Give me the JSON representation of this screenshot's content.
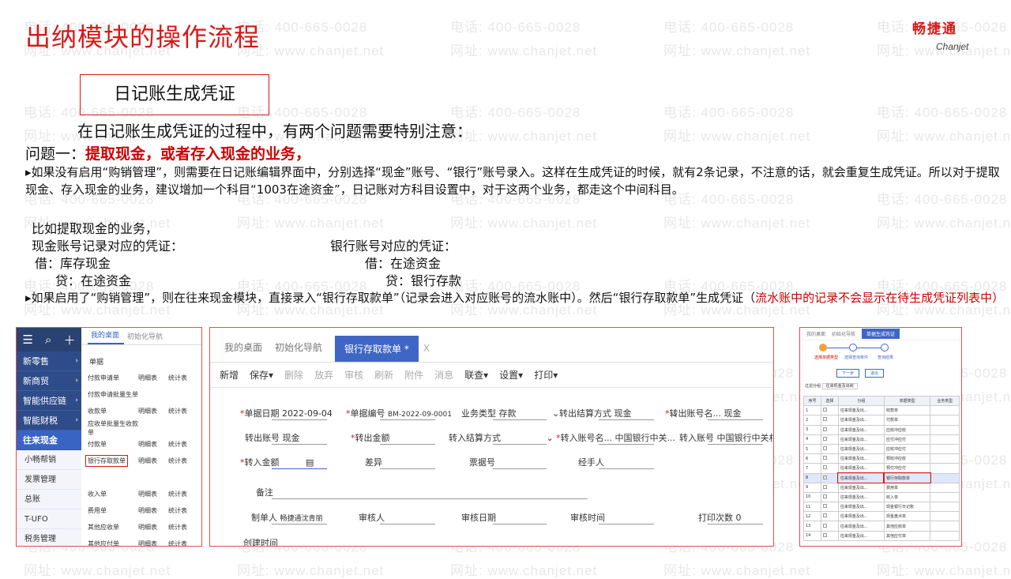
{
  "title": "出纳模块的操作流程",
  "logo": {
    "cn": "畅捷通",
    "en": "Chanjet"
  },
  "watermark": {
    "phone": "电话: 400-665-0028",
    "site": "网址: www.chanjet.net"
  },
  "section_box": "日记账生成凭证",
  "intro": "在日记账生成凭证的过程中，有两个问题需要特别注意：",
  "question1": {
    "prefix": "问题一：",
    "highlight": "提取现金，或者存入现金的业务，"
  },
  "para1": "▸如果没有启用“购销管理”，则需要在日记账编辑界面中，分别选择“现金”账号、“银行”账号录入。这样在生成凭证的时候，就有2条记录，不注意的话，就会重复生成凭证。所以对于提取现金、存入现金的业务，建议增加一个科目“1003在途资金”，日记账对方科目设置中，对于这两个业务，都走这个中间科目。",
  "example": {
    "line1": "比如提取现金的业务，",
    "cash_title": "现金账号记录对应的凭证：",
    "cash_debit": "借：库存现金",
    "cash_credit": "贷：在途资金",
    "bank_title": "银行账号对应的凭证：",
    "bank_debit": "借：在途资金",
    "bank_credit": "贷：银行存款"
  },
  "para2": "▸如果启用了“购销管理”，则在往来现金模块，直接录入“银行存取款单”（记录会进入对应账号的流水账中）。然后“银行存取款单”生成凭证（",
  "para2_red": "流水账中的记录不会显示在待生成凭证列表中）",
  "left_panel": {
    "nav": [
      "新零售",
      "新商贸",
      "智能供应链",
      "智能财税",
      "往来现金",
      "小畅帮销",
      "发票管理",
      "总账",
      "T-UFO",
      "税务管理"
    ],
    "tabs": [
      "我的桌面",
      "初始化导航"
    ],
    "section": "单据",
    "rows": [
      [
        "付款申请单",
        "明细表",
        "统计表"
      ],
      [
        "付款申请批量生单",
        "",
        ""
      ],
      [
        "收款单",
        "明细表",
        "统计表"
      ],
      [
        "应收单批量生收款单",
        "",
        ""
      ],
      [
        "付款单",
        "明细表",
        "统计表"
      ],
      [
        "银行存取款单",
        "明细表",
        "统计表"
      ],
      [
        "",
        "",
        ""
      ],
      [
        "收入单",
        "明细表",
        "统计表"
      ],
      [
        "费用单",
        "明细表",
        "统计表"
      ],
      [
        "其他应收单",
        "明细表",
        "统计表"
      ],
      [
        "其他应付单",
        "明细表",
        "统计表"
      ]
    ]
  },
  "middle_panel": {
    "tabs": [
      "我的桌面",
      "初始化导航",
      "银行存取款单 *",
      "X"
    ],
    "toolbar": [
      "新增",
      "保存▾",
      "删除",
      "放弃",
      "审核",
      "刷新",
      "附件",
      "消息",
      "联查▾",
      "设置▾",
      "打印▾"
    ],
    "fields": {
      "date_label": "单据日期",
      "date_value": "2022-09-04",
      "no_label": "单据编号",
      "no_value": "BM-2022-09-0001",
      "type_label": "业务类型",
      "type_value": "存款",
      "out_method_label": "转出结算方式",
      "out_method_value": "现金",
      "out_acct_label": "转出账号名...",
      "out_acct_value": "现金",
      "out_no_label": "转出账号",
      "out_no_value": "现金",
      "out_amt_label": "转出金额",
      "in_method_label": "转入结算方式",
      "in_acct_label": "转入账号名...",
      "in_acct_value": "中国银行中关...",
      "in_no_label": "转入账号",
      "in_no_value": "中国银行中关村支行",
      "in_amt_label": "转入金额",
      "diff_label": "差异",
      "bill_label": "票据号",
      "handler_label": "经手人",
      "remark_label": "备注",
      "maker_label": "制单人",
      "maker_value": "畅捷通沈青丽",
      "auditor_label": "审核人",
      "audit_date_label": "审核日期",
      "audit_time_label": "审核时间",
      "print_label": "打印次数",
      "print_value": "0",
      "created_label": "创建时间"
    }
  },
  "right_panel": {
    "tabs": [
      "我的桌面",
      "初始化导航",
      "单据生成凭证"
    ],
    "steps": [
      "选择单据类型",
      "选择查询条件",
      "查询结果"
    ],
    "buttons": [
      "下一步",
      "退出"
    ],
    "filter": "往来现金及出纳",
    "headers": [
      "序号",
      "选择",
      "分组",
      "单据类型",
      "业务类型"
    ],
    "rows": [
      [
        "1",
        "往来现金及出...",
        "收款单"
      ],
      [
        "2",
        "往来现金及出...",
        "付款单"
      ],
      [
        "3",
        "往来现金及出...",
        "应收冲应收"
      ],
      [
        "4",
        "往来现金及出...",
        "应付冲应付"
      ],
      [
        "5",
        "往来现金及出...",
        "应收冲应付"
      ],
      [
        "6",
        "往来现金及出...",
        "预收冲应收"
      ],
      [
        "7",
        "往来现金及出...",
        "预付冲应付"
      ],
      [
        "8",
        "往来现金及出...",
        "银行存取款单"
      ],
      [
        "9",
        "往来现金及出...",
        "费用单"
      ],
      [
        "10",
        "往来现金及出...",
        "收入单"
      ],
      [
        "11",
        "往来现金及出...",
        "现金银行日记账"
      ],
      [
        "12",
        "往来现金及出...",
        "现金盘点单"
      ],
      [
        "13",
        "往来现金及出...",
        "其他应收单"
      ],
      [
        "14",
        "往来现金及出...",
        "其他应付单"
      ]
    ]
  }
}
